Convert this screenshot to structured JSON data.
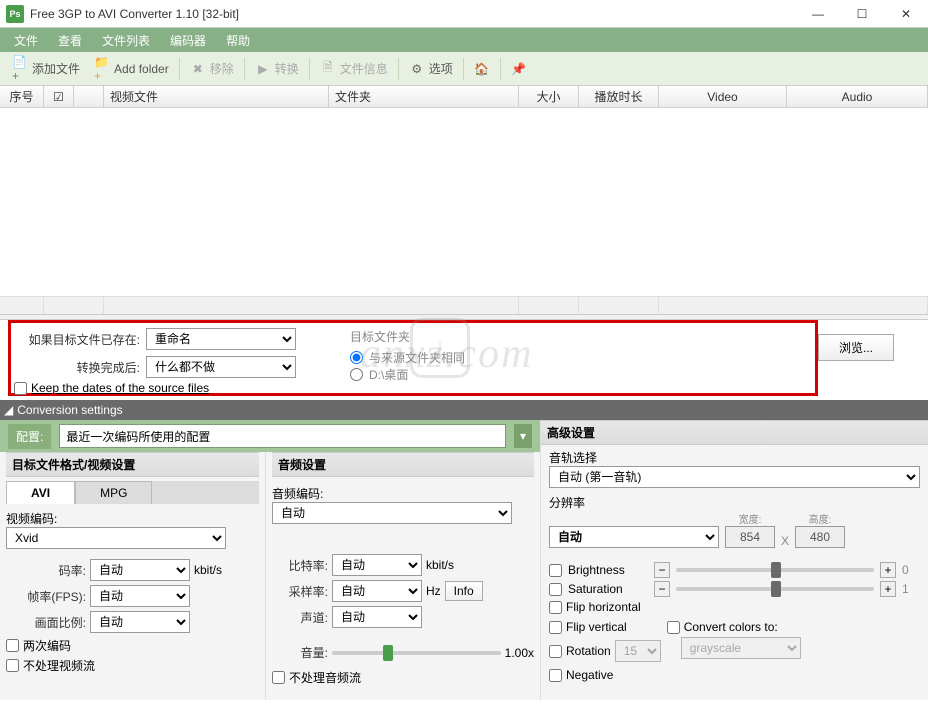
{
  "app": {
    "icon_text": "Ps",
    "title": "Free 3GP to AVI Converter 1.10   [32-bit]"
  },
  "menubar": [
    "文件",
    "查看",
    "文件列表",
    "编码器",
    "帮助"
  ],
  "toolbar": {
    "add_files": "添加文件",
    "add_folder": "Add folder",
    "remove": "移除",
    "convert": "转换",
    "file_info": "文件信息",
    "options": "选项"
  },
  "table": {
    "headers": {
      "index": "序号",
      "checkbox": "☑",
      "video_file": "视频文件",
      "folder": "文件夹",
      "size": "大小",
      "duration": "播放时长",
      "video": "Video",
      "audio": "Audio"
    }
  },
  "output": {
    "if_exists_label": "如果目标文件已存在:",
    "if_exists_value": "重命名",
    "after_convert_label": "转换完成后:",
    "after_convert_value": "什么都不做",
    "keep_dates": "Keep the dates of the source files",
    "target_folder_label": "目标文件夹",
    "same_as_source": "与来源文件夹相同",
    "desktop": "D:\\桌面",
    "browse": "浏览..."
  },
  "cs_header": "Conversion settings",
  "profile": {
    "label": "配置:",
    "value": "最近一次编码所使用的配置"
  },
  "video_section": {
    "title": "目标文件格式/视频设置",
    "tabs": {
      "avi": "AVI",
      "mpg": "MPG"
    },
    "video_codec_label": "视频编码:",
    "video_codec": "Xvid",
    "bitrate_label": "码率:",
    "bitrate": "自动",
    "bitrate_unit": "kbit/s",
    "fps_label": "帧率(FPS):",
    "fps": "自动",
    "aspect_label": "画面比例:",
    "aspect": "自动",
    "two_pass": "两次编码",
    "no_video": "不处理视频流"
  },
  "audio_section": {
    "title": "音频设置",
    "codec_label": "音频编码:",
    "codec": "自动",
    "bitrate_label": "比特率:",
    "bitrate": "自动",
    "bitrate_unit": "kbit/s",
    "sample_label": "采样率:",
    "sample": "自动",
    "sample_unit": "Hz",
    "channels_label": "声道:",
    "channels": "自动",
    "info_btn": "Info",
    "volume_label": "音量:",
    "volume_value": "1.00x",
    "no_audio": "不处理音频流"
  },
  "advanced": {
    "title": "高级设置",
    "track_label": "音轨选择",
    "track": "自动 (第一音轨)",
    "resolution_label": "分辨率",
    "resolution": "自动",
    "width_label": "宽度:",
    "width": "854",
    "height_label": "高度:",
    "height": "480",
    "x": "X",
    "brightness": "Brightness",
    "brightness_val": "0",
    "saturation": "Saturation",
    "saturation_val": "1",
    "flip_h": "Flip horizontal",
    "flip_v": "Flip vertical",
    "rotation": "Rotation",
    "rotation_val": "15",
    "convert_colors": "Convert colors to:",
    "convert_colors_val": "grayscale",
    "negative": "Negative"
  }
}
